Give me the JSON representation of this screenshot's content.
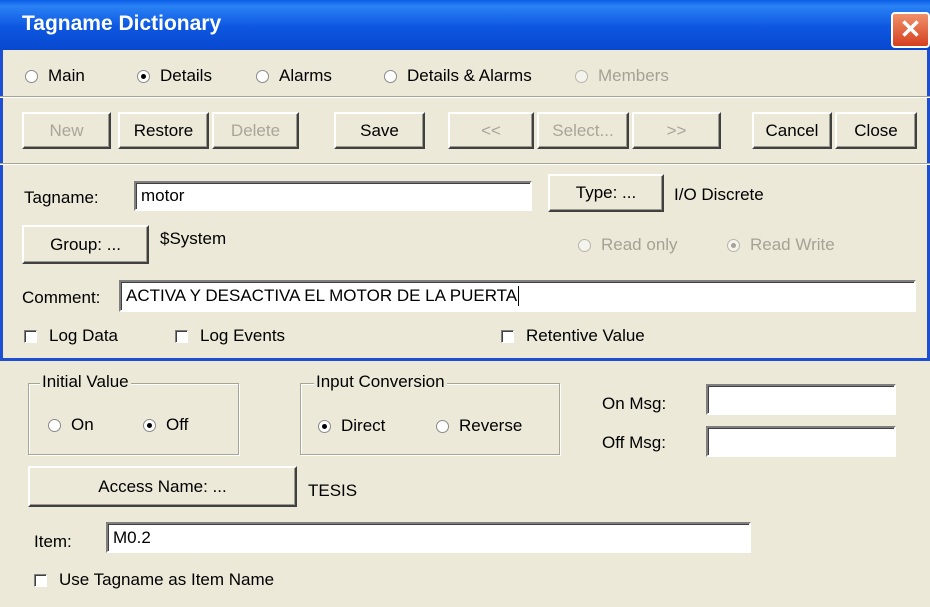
{
  "window": {
    "title": "Tagname Dictionary",
    "close_glyph": "✕"
  },
  "view_modes": [
    {
      "label": "Main",
      "selected": false,
      "enabled": true
    },
    {
      "label": "Details",
      "selected": true,
      "enabled": true
    },
    {
      "label": "Alarms",
      "selected": false,
      "enabled": true
    },
    {
      "label": "Details & Alarms",
      "selected": false,
      "enabled": true
    },
    {
      "label": "Members",
      "selected": false,
      "enabled": false
    }
  ],
  "toolbar": {
    "new": "New",
    "restore": "Restore",
    "delete": "Delete",
    "save": "Save",
    "prev": "<<",
    "select": "Select...",
    "next": ">>",
    "cancel": "Cancel",
    "close": "Close"
  },
  "tag": {
    "tagname_label": "Tagname:",
    "tagname_value": "motor",
    "type_button": "Type: ...",
    "type_value": "I/O Discrete",
    "group_button": "Group: ...",
    "group_value": "$System",
    "read_only": "Read only",
    "read_write": "Read Write",
    "comment_label": "Comment:",
    "comment_value": "ACTIVA Y DESACTIVA EL MOTOR DE LA PUERTA",
    "log_data": "Log Data",
    "log_events": "Log Events",
    "retentive_value": "Retentive Value"
  },
  "details": {
    "initial_value_title": "Initial Value",
    "on": "On",
    "off": "Off",
    "input_conversion_title": "Input Conversion",
    "direct": "Direct",
    "reverse": "Reverse",
    "on_msg_label": "On Msg:",
    "on_msg_value": "",
    "off_msg_label": "Off Msg:",
    "off_msg_value": "",
    "access_name_button": "Access Name: ...",
    "access_name_value": "TESIS",
    "item_label": "Item:",
    "item_value": "M0.2",
    "use_tagname_label": "Use Tagname as Item Name"
  },
  "colors": {
    "titlebar": "#0a5ee8",
    "face": "#ece9d8",
    "accent_blue": "#1c4fd4"
  }
}
